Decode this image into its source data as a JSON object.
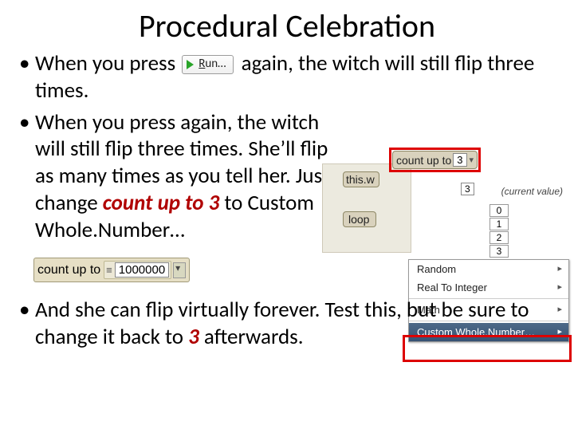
{
  "title": "Procedural Celebration",
  "bullet1": {
    "pre": "When you press ",
    "post": " again, the witch will still flip three times."
  },
  "run_button": {
    "label": "Run…",
    "underline": "R"
  },
  "bullet2": {
    "text_a": "When you press again, the witch will still flip three times.  She’ll flip as many times as you tell her.  Just change ",
    "emph": "count up to 3",
    "text_b": " to Custom Whole.Number…"
  },
  "panel": {
    "count_up_to_label": "count up to",
    "count_up_to_value": "3",
    "this_w_label": "this.w",
    "this_w_val": "3",
    "current_note": "(current value)",
    "loop_label": "loop",
    "options": [
      "0",
      "1",
      "2",
      "3"
    ],
    "menu": {
      "random": "Random",
      "rti": "Real To Integer",
      "math": "Math",
      "custom": "Custom Whole.Number…"
    }
  },
  "big_tile": {
    "label": "count up to",
    "value": "1000000"
  },
  "bullet3": {
    "a": "And she can flip virtually forever.  Test this, but be sure to change it back to ",
    "three": "3",
    "b": " afterwards."
  }
}
